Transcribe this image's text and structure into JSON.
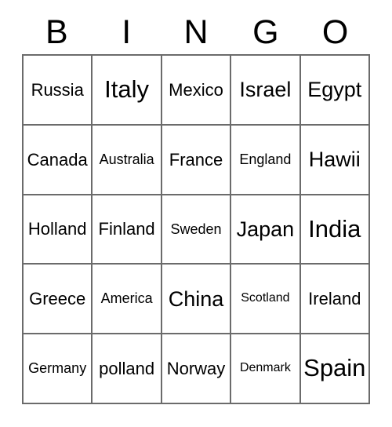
{
  "card": {
    "type": "bingo-card",
    "title_letters": [
      "B",
      "I",
      "N",
      "G",
      "O"
    ],
    "columns": 5,
    "rows": 5,
    "colors": {
      "background": "#ffffff",
      "border": "#6b6b6b",
      "text": "#000000"
    },
    "cells": [
      [
        {
          "label": "Russia",
          "size": "md"
        },
        {
          "label": "Italy",
          "size": "xl"
        },
        {
          "label": "Mexico",
          "size": "md"
        },
        {
          "label": "Israel",
          "size": "lg"
        },
        {
          "label": "Egypt",
          "size": "lg"
        }
      ],
      [
        {
          "label": "Canada",
          "size": "md"
        },
        {
          "label": "Australia",
          "size": "sm"
        },
        {
          "label": "France",
          "size": "md"
        },
        {
          "label": "England",
          "size": "sm"
        },
        {
          "label": "Hawii",
          "size": "lg"
        }
      ],
      [
        {
          "label": "Holland",
          "size": "md"
        },
        {
          "label": "Finland",
          "size": "md"
        },
        {
          "label": "Sweden",
          "size": "sm"
        },
        {
          "label": "Japan",
          "size": "lg"
        },
        {
          "label": "India",
          "size": "xl"
        }
      ],
      [
        {
          "label": "Greece",
          "size": "md"
        },
        {
          "label": "America",
          "size": "sm"
        },
        {
          "label": "China",
          "size": "lg"
        },
        {
          "label": "Scotland",
          "size": "xs"
        },
        {
          "label": "Ireland",
          "size": "md"
        }
      ],
      [
        {
          "label": "Germany",
          "size": "sm"
        },
        {
          "label": "polland",
          "size": "md"
        },
        {
          "label": "Norway",
          "size": "md"
        },
        {
          "label": "Denmark",
          "size": "xs"
        },
        {
          "label": "Spain",
          "size": "xl"
        }
      ]
    ]
  }
}
